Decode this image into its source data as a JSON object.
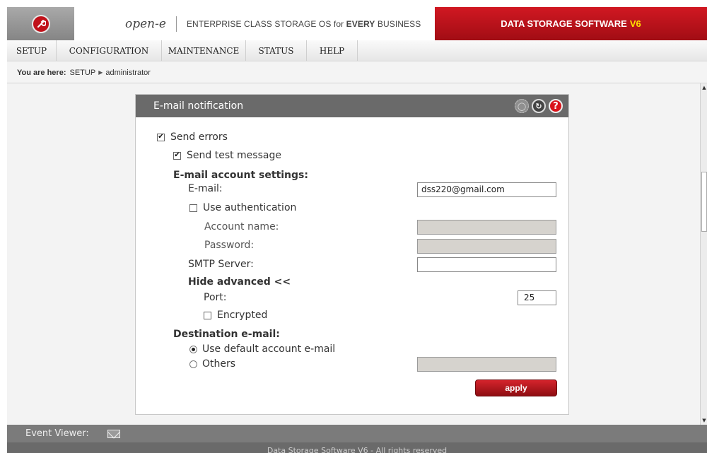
{
  "header": {
    "brand_name": "open-e",
    "tagline_pre": "ENTERPRISE CLASS STORAGE OS for ",
    "tagline_bold": "EVERY",
    "tagline_post": " BUSINESS",
    "product": "DATA STORAGE SOFTWARE",
    "product_version": "V6",
    "logo_icon": "wrench-icon",
    "logo_color": "#c0121a",
    "product_color": "#c0121a"
  },
  "menu": [
    {
      "label": "SETUP"
    },
    {
      "label": "CONFIGURATION"
    },
    {
      "label": "MAINTENANCE"
    },
    {
      "label": "STATUS"
    },
    {
      "label": "HELP"
    }
  ],
  "breadcrumb": {
    "prefix": "You are here:",
    "items": [
      "SETUP",
      "administrator"
    ]
  },
  "panel": {
    "title": "E-mail notification",
    "icons": [
      "options-icon",
      "refresh-icon",
      "help-icon"
    ],
    "send_errors": {
      "label": "Send errors",
      "checked": true
    },
    "send_test": {
      "label": "Send test message",
      "checked": true
    },
    "account_heading": "E-mail account settings:",
    "email": {
      "label": "E-mail:",
      "value": "dss220@gmail.com"
    },
    "use_auth": {
      "label": "Use authentication",
      "checked": false
    },
    "account_name": {
      "label": "Account name:",
      "value": ""
    },
    "password": {
      "label": "Password:",
      "value": ""
    },
    "smtp": {
      "label": "SMTP Server:",
      "value": ""
    },
    "advanced_link": "Hide advanced <<",
    "port": {
      "label": "Port:",
      "value": "25"
    },
    "encrypted": {
      "label": "Encrypted",
      "checked": false
    },
    "destination_heading": "Destination e-mail:",
    "dest_default": {
      "label": "Use default account e-mail",
      "selected": true
    },
    "dest_others": {
      "label": "Others",
      "selected": false,
      "value": ""
    },
    "apply_label": "apply"
  },
  "footer": {
    "event_viewer": "Event Viewer:",
    "copyright": "Data Storage Software V6 - All rights reserved"
  }
}
